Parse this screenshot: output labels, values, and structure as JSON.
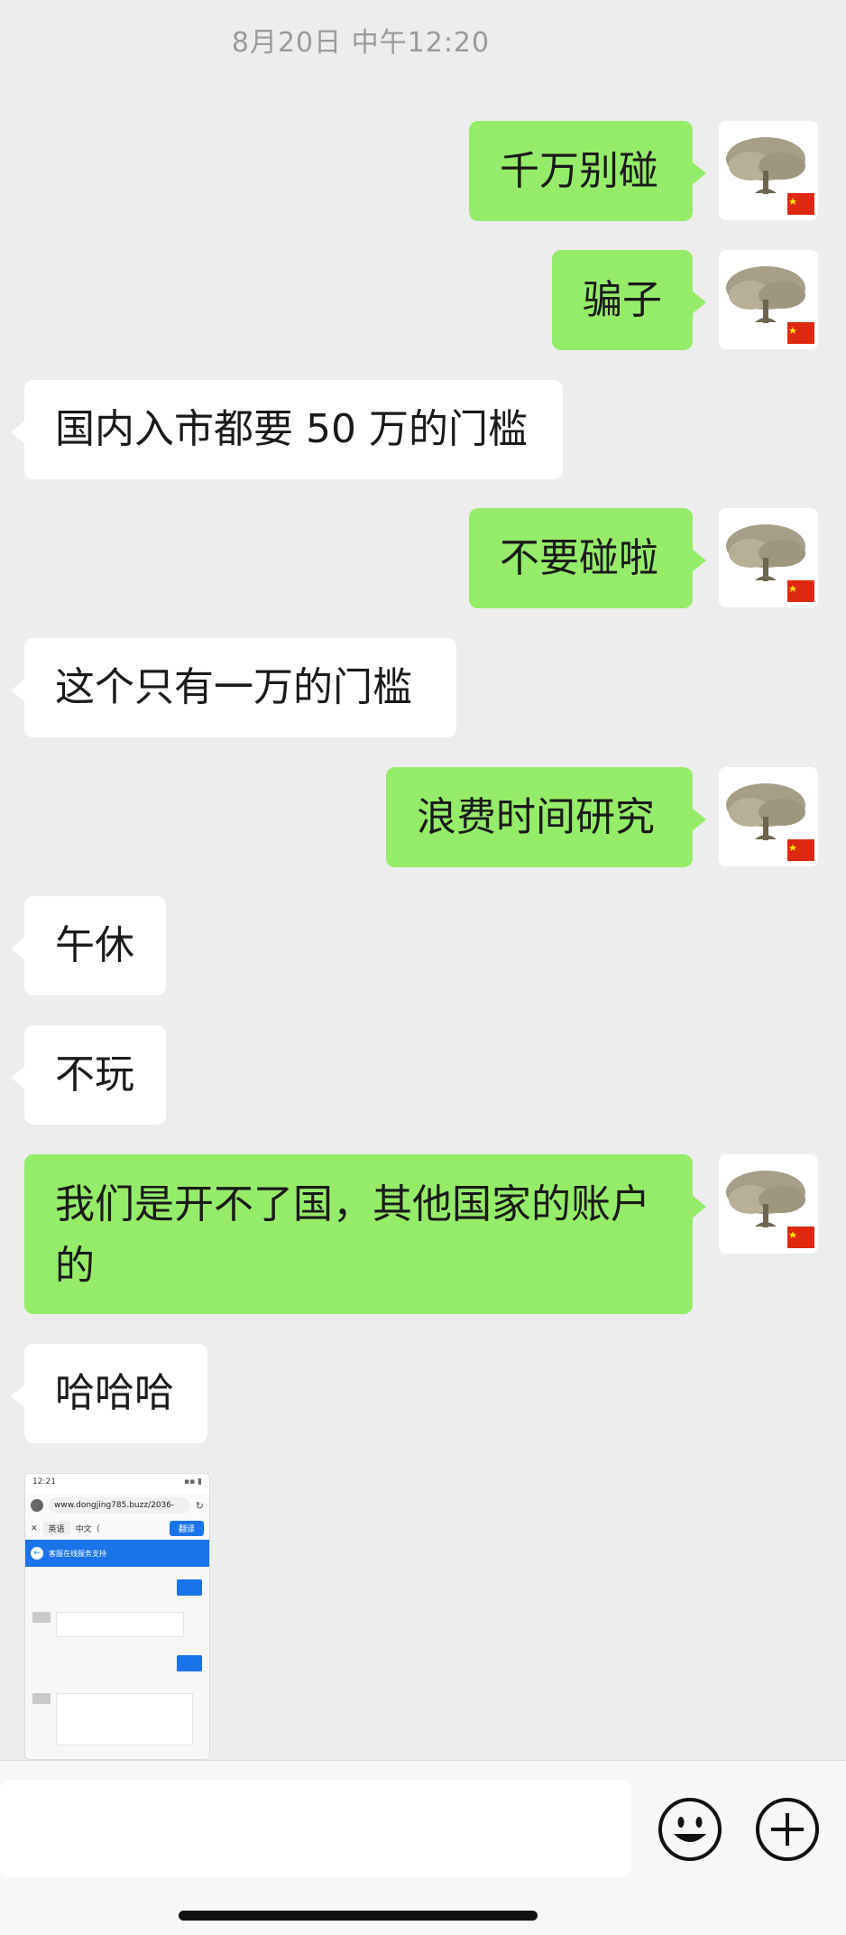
{
  "timestamp": "8月20日 中午12:20",
  "messages": [
    {
      "side": "out",
      "text": "千万别碰"
    },
    {
      "side": "out",
      "text": "骗子"
    },
    {
      "side": "in",
      "text": "国内入市都要 50 万的门槛"
    },
    {
      "side": "out",
      "text": "不要碰啦"
    },
    {
      "side": "in",
      "text": "这个只有一万的门槛"
    },
    {
      "side": "out",
      "text": "浪费时间研究"
    },
    {
      "side": "in",
      "text": "午休"
    },
    {
      "side": "in",
      "text": "不玩"
    },
    {
      "side": "out",
      "text": "我们是开不了国，其他国家的账户的"
    },
    {
      "side": "in",
      "text": "哈哈哈"
    }
  ],
  "screenshot_thumb": {
    "status_time": "12:21",
    "url": "www.dongjing785.buzz/2036-",
    "tab_label": "英语",
    "lang_label": "中文（",
    "action_button": "翻译",
    "header_text": "客服在线服务支持"
  },
  "toolbar": {
    "emoji_icon": "emoji-icon",
    "plus_icon": "plus-icon"
  },
  "colors": {
    "outgoing_bubble": "#95ec69",
    "incoming_bubble": "#ffffff",
    "background": "#ededed"
  }
}
